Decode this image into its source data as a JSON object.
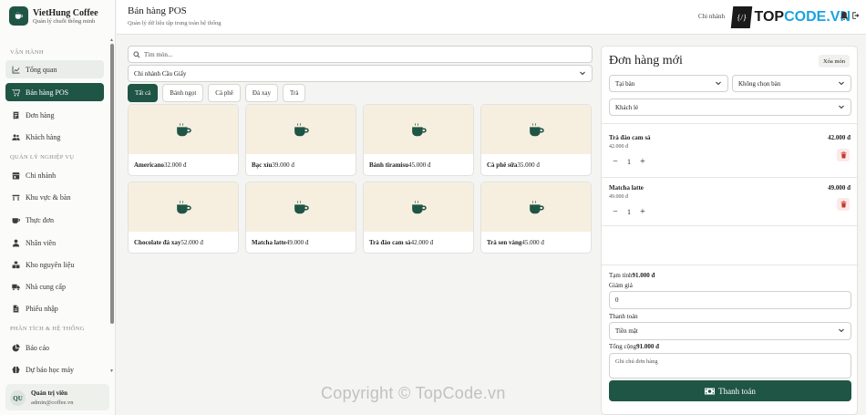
{
  "brand": {
    "name": "VietHung Coffee",
    "tagline": "Quản lý chuỗi thông minh"
  },
  "sidebar": {
    "sections": [
      {
        "title": "VẬN HÀNH"
      },
      {
        "title": "QUẢN LÝ NGHIỆP VỤ"
      },
      {
        "title": "PHÂN TÍCH & HỆ THỐNG"
      }
    ],
    "items": [
      {
        "label": "Tổng quan",
        "icon": "chart-line-icon"
      },
      {
        "label": "Bán hàng POS",
        "icon": "cart-icon",
        "active": true
      },
      {
        "label": "Đơn hàng",
        "icon": "receipt-icon"
      },
      {
        "label": "Khách hàng",
        "icon": "users-icon"
      },
      {
        "label": "Chi nhánh",
        "icon": "store-icon"
      },
      {
        "label": "Khu vực & bàn",
        "icon": "table-icon"
      },
      {
        "label": "Thực đơn",
        "icon": "mug-icon"
      },
      {
        "label": "Nhân viên",
        "icon": "user-icon"
      },
      {
        "label": "Kho nguyên liệu",
        "icon": "boxes-icon"
      },
      {
        "label": "Nhà cung cấp",
        "icon": "truck-icon"
      },
      {
        "label": "Phiếu nhập",
        "icon": "document-icon"
      },
      {
        "label": "Báo cáo",
        "icon": "pie-chart-icon"
      },
      {
        "label": "Dự báo học máy",
        "icon": "brain-icon"
      }
    ]
  },
  "user": {
    "initials": "QU",
    "name": "Quản trị viên",
    "email": "admin@coffee.vn"
  },
  "header": {
    "title": "Bán hàng POS",
    "subtitle": "Quản lý dữ liệu tập trung toàn hệ thống",
    "branch_label": "Chi nhánh",
    "watermark_logo": {
      "prefix": "TOP",
      "suffix": "CODE.VN"
    }
  },
  "pos": {
    "search_placeholder": "Tìm món...",
    "branch": "Chi nhánh Cầu Giấy",
    "categories": [
      "Tất cả",
      "Bánh ngọt",
      "Cà phê",
      "Đá xay",
      "Trà"
    ],
    "products": [
      {
        "name": "Americano",
        "price": "32.000 đ"
      },
      {
        "name": "Bạc xỉu",
        "price": "39.000 đ"
      },
      {
        "name": "Bánh tiramisu",
        "price": "45.000 đ"
      },
      {
        "name": "Cà phê sữa",
        "price": "35.000 đ"
      },
      {
        "name": "Chocolate đá xay",
        "price": "52.000 đ"
      },
      {
        "name": "Matcha latte",
        "price": "49.000 đ"
      },
      {
        "name": "Trà đào cam sả",
        "price": "42.000 đ"
      },
      {
        "name": "Trà sen vàng",
        "price": "45.000 đ"
      }
    ]
  },
  "order": {
    "title": "Đơn hàng mới",
    "clear_label": "Xóa món",
    "order_type": "Tại bàn",
    "table": "Không chọn bàn",
    "customer": "Khách lẻ",
    "items": [
      {
        "name": "Trà đào cam sả",
        "unit_price": "42.000 đ",
        "total": "42.000 đ",
        "qty": "1"
      },
      {
        "name": "Matcha latte",
        "unit_price": "49.000 đ",
        "total": "49.000 đ",
        "qty": "1"
      }
    ],
    "subtotal_label": "Tạm tính",
    "subtotal": "91.000 đ",
    "discount_label": "Giảm giá",
    "discount": "0",
    "payment_label": "Thanh toán",
    "payment_method": "Tiền mặt",
    "total_label": "Tổng cộng",
    "total": "91.000 đ",
    "note_placeholder": "Ghi chú đơn hàng",
    "checkout_label": "Thanh toán"
  },
  "watermark": {
    "text": "Copyright © TopCode.vn"
  }
}
